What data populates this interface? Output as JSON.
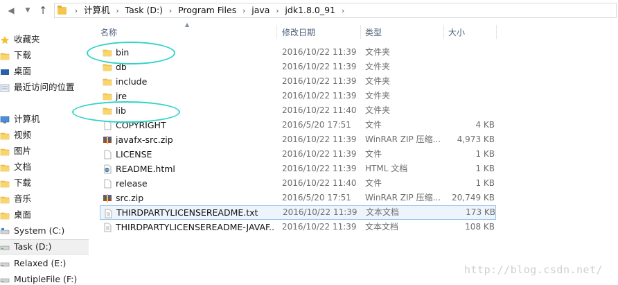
{
  "breadcrumb": [
    "计算机",
    "Task (D:)",
    "Program Files",
    "java",
    "jdk1.8.0_91"
  ],
  "columns": {
    "name": "名称",
    "date": "修改日期",
    "type": "类型",
    "size": "大小"
  },
  "sidebar": {
    "items": [
      {
        "label": "收藏夹",
        "icon": "star-icon"
      },
      {
        "label": "下载",
        "icon": "download-folder-icon"
      },
      {
        "label": "桌面",
        "icon": "desktop-icon"
      },
      {
        "label": "最近访问的位置",
        "icon": "recent-places-icon"
      },
      {
        "label": "计算机",
        "icon": "computer-icon"
      },
      {
        "label": "视频",
        "icon": "videos-folder-icon"
      },
      {
        "label": "图片",
        "icon": "pictures-folder-icon"
      },
      {
        "label": "文档",
        "icon": "documents-folder-icon"
      },
      {
        "label": "下载",
        "icon": "download-folder-icon"
      },
      {
        "label": "音乐",
        "icon": "music-folder-icon"
      },
      {
        "label": "桌面",
        "icon": "desktop-folder-icon"
      },
      {
        "label": "System (C:)",
        "icon": "system-drive-icon"
      },
      {
        "label": "Task (D:)",
        "icon": "drive-icon",
        "selected": true
      },
      {
        "label": "Relaxed (E:)",
        "icon": "drive-icon"
      },
      {
        "label": "MutipleFile (F:)",
        "icon": "drive-icon"
      }
    ]
  },
  "files": [
    {
      "name": "bin",
      "date": "2016/10/22 11:39",
      "type": "文件夹",
      "size": "",
      "icon": "folder"
    },
    {
      "name": "db",
      "date": "2016/10/22 11:39",
      "type": "文件夹",
      "size": "",
      "icon": "folder"
    },
    {
      "name": "include",
      "date": "2016/10/22 11:39",
      "type": "文件夹",
      "size": "",
      "icon": "folder"
    },
    {
      "name": "jre",
      "date": "2016/10/22 11:39",
      "type": "文件夹",
      "size": "",
      "icon": "folder"
    },
    {
      "name": "lib",
      "date": "2016/10/22 11:40",
      "type": "文件夹",
      "size": "",
      "icon": "folder"
    },
    {
      "name": "COPYRIGHT",
      "date": "2016/5/20 17:51",
      "type": "文件",
      "size": "4 KB",
      "icon": "file"
    },
    {
      "name": "javafx-src.zip",
      "date": "2016/10/22 11:39",
      "type": "WinRAR ZIP 压缩...",
      "size": "4,973 KB",
      "icon": "zip"
    },
    {
      "name": "LICENSE",
      "date": "2016/10/22 11:39",
      "type": "文件",
      "size": "1 KB",
      "icon": "file"
    },
    {
      "name": "README.html",
      "date": "2016/10/22 11:39",
      "type": "HTML 文档",
      "size": "1 KB",
      "icon": "html"
    },
    {
      "name": "release",
      "date": "2016/10/22 11:40",
      "type": "文件",
      "size": "1 KB",
      "icon": "file"
    },
    {
      "name": "src.zip",
      "date": "2016/5/20 17:51",
      "type": "WinRAR ZIP 压缩...",
      "size": "20,749 KB",
      "icon": "zip"
    },
    {
      "name": "THIRDPARTYLICENSEREADME.txt",
      "date": "2016/10/22 11:39",
      "type": "文本文档",
      "size": "173 KB",
      "icon": "txt",
      "highlighted": true
    },
    {
      "name": "THIRDPARTYLICENSEREADME-JAVAF...",
      "date": "2016/10/22 11:39",
      "type": "文本文档",
      "size": "108 KB",
      "icon": "txt"
    }
  ],
  "annotations": [
    "bin",
    "lib"
  ],
  "watermark": "http://blog.csdn.net/",
  "colors": {
    "annotation": "#2fd3c9",
    "folder": "#f4c64e",
    "highlight_border": "#99c6ee",
    "header_text": "#4c607a"
  }
}
